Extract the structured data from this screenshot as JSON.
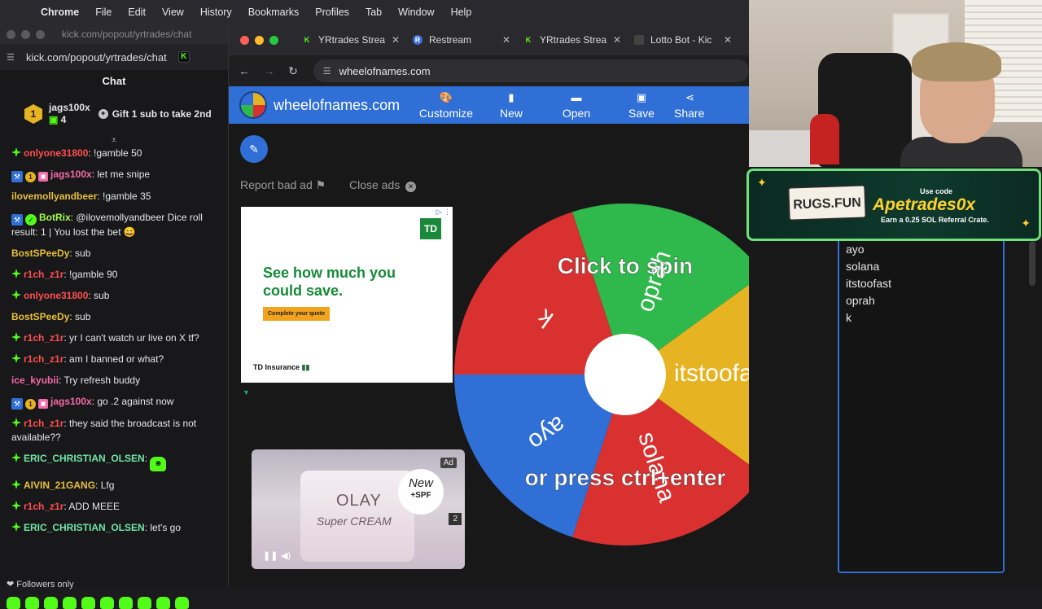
{
  "menubar": {
    "items": [
      "Chrome",
      "File",
      "Edit",
      "View",
      "History",
      "Bookmarks",
      "Profiles",
      "Tab",
      "Window",
      "Help"
    ]
  },
  "chat_window": {
    "titlebar_url": "kick.com/popout/yrtrades/chat",
    "address": "kick.com/popout/yrtrades/chat",
    "heading": "Chat",
    "pinned_gifter": {
      "username": "jags100x",
      "count": "4",
      "rank": "1"
    },
    "gift_prompt": "Gift 1 sub to take 2nd",
    "messages": [
      {
        "user": "onlyone31800",
        "text": ": !gamble 50"
      },
      {
        "user": "jags100x",
        "text": ": let me snipe"
      },
      {
        "user": "ilovemollyandbeer",
        "text": ": !gamble 35"
      },
      {
        "user": "BotRix",
        "text": ": @ilovemollyandbeer Dice roll result: 1 | You lost the bet 😄"
      },
      {
        "user": "BostSPeeDy",
        "text": ": sub"
      },
      {
        "user": "r1ch_z1r",
        "text": ": !gamble 90"
      },
      {
        "user": "onlyone31800",
        "text": ": sub"
      },
      {
        "user": "BostSPeeDy",
        "text": ": sub"
      },
      {
        "user": "r1ch_z1r",
        "text": ": yr I can't watch ur live on X tf?"
      },
      {
        "user": "r1ch_z1r",
        "text": ": am I banned or what?"
      },
      {
        "user": "ice_kyubii",
        "text": ": Try refresh buddy"
      },
      {
        "user": "jags100x",
        "text": ": go .2 against now"
      },
      {
        "user": "r1ch_z1r",
        "text": ": they said the broadcast is not available??"
      },
      {
        "user": "ERIC_CHRISTIAN_OLSEN",
        "text": ":"
      },
      {
        "user": "AIVIN_21GANG",
        "text": ": Lfg"
      },
      {
        "user": "r1ch_z1r",
        "text": ": ADD MEEE"
      },
      {
        "user": "ERIC_CHRISTIAN_OLSEN",
        "text": ": let's go"
      }
    ],
    "followers_only": "Followers only"
  },
  "browser": {
    "tabs": [
      {
        "title": "YRtrades Strea",
        "icon": "kick-icon"
      },
      {
        "title": "Restream",
        "icon": "restream-icon"
      },
      {
        "title": "YRtrades Strea",
        "icon": "kick-icon"
      },
      {
        "title": "Lotto Bot - Kic",
        "icon": "lotto-icon"
      }
    ],
    "address": "wheelofnames.com"
  },
  "wheelofnames": {
    "site_title": "wheelofnames.com",
    "nav": [
      "Customize",
      "New",
      "Open",
      "Save",
      "Share"
    ],
    "report_ad": "Report bad ad",
    "close_ads": "Close ads",
    "ad_td": {
      "headline": "See how much you could save.",
      "cta": "Complete your quote",
      "brand": "TD Insurance",
      "logo": "TD"
    },
    "ad_olay": {
      "brand": "OLAY",
      "product": "Super CREAM",
      "badge_new": "New",
      "badge_spf": "+SPF",
      "ad_label": "Ad",
      "counter": "2"
    },
    "wheel": {
      "prompt_top": "Click to spin",
      "prompt_bottom": "or press ctrl+enter",
      "segments": [
        {
          "label": "itstoofast",
          "color": "#e6b422"
        },
        {
          "label": "solana",
          "color": "#d93030"
        },
        {
          "label": "ayo",
          "color": "#2f6fd6"
        },
        {
          "label": "k",
          "color": "#d93030"
        },
        {
          "label": "oprah",
          "color": "#2fb84b"
        }
      ]
    },
    "entries": [
      "ayo",
      "solana",
      "itstoofast",
      "oprah",
      "k"
    ]
  },
  "overlay": {
    "promo_brand": "RUGS.FUN",
    "promo_use_code": "Use code",
    "promo_code": "Apetrades0x",
    "promo_earn": "Earn a 0.25 SOL Referral Crate."
  }
}
